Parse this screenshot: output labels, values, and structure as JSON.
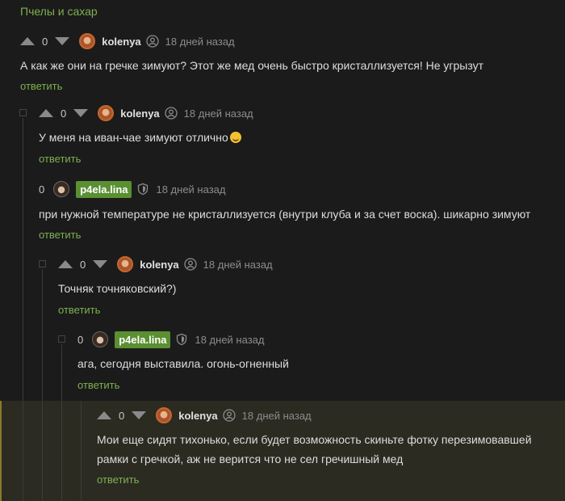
{
  "topic": "Пчелы и сахар",
  "colors": {
    "accent": "#7eb04f",
    "badge": "#5a8f32",
    "highlight_border": "#8a7a28"
  },
  "comments": [
    {
      "score": "0",
      "user": "kolenya",
      "badge": false,
      "date": "18 дней назад",
      "text": "А как же они на гречке зимуют? Этот же мед очень быстро кристаллизуется! Не угрызут",
      "reply": "ответить",
      "avatar_icon": "user-avatar",
      "user_icon": "user-icon"
    },
    {
      "score": "0",
      "user": "kolenya",
      "badge": false,
      "date": "18 дней назад",
      "text": "У меня на иван-чае зимуют отлично",
      "emoji": "wink-smiley-icon",
      "reply": "ответить",
      "avatar_icon": "user-avatar",
      "user_icon": "user-icon"
    },
    {
      "score": "0",
      "user": "p4ela.lina",
      "badge": true,
      "date": "18 дней назад",
      "text": "при нужной температуре не кристаллизуется (внутри клуба и за счет воска). шикарно зимуют",
      "reply": "ответить",
      "avatar_icon": "user-avatar",
      "user_icon": "shield-icon"
    },
    {
      "score": "0",
      "user": "kolenya",
      "badge": false,
      "date": "18 дней назад",
      "text": "Точняк точняковский?)",
      "reply": "ответить",
      "avatar_icon": "user-avatar",
      "user_icon": "user-icon"
    },
    {
      "score": "0",
      "user": "p4ela.lina",
      "badge": true,
      "date": "18 дней назад",
      "text": "ага, сегодня выставила. огонь-огненный",
      "reply": "ответить",
      "avatar_icon": "user-avatar",
      "user_icon": "shield-icon"
    },
    {
      "score": "0",
      "user": "kolenya",
      "badge": false,
      "date": "18 дней назад",
      "text_line1": "Мои еще сидят тихонько, если будет возможность скиньте фотку перезимовавшей",
      "text_line2": "рамки с гречкой, аж не верится что не сел гречишный мед",
      "reply": "ответить",
      "avatar_icon": "user-avatar",
      "user_icon": "user-icon"
    }
  ]
}
